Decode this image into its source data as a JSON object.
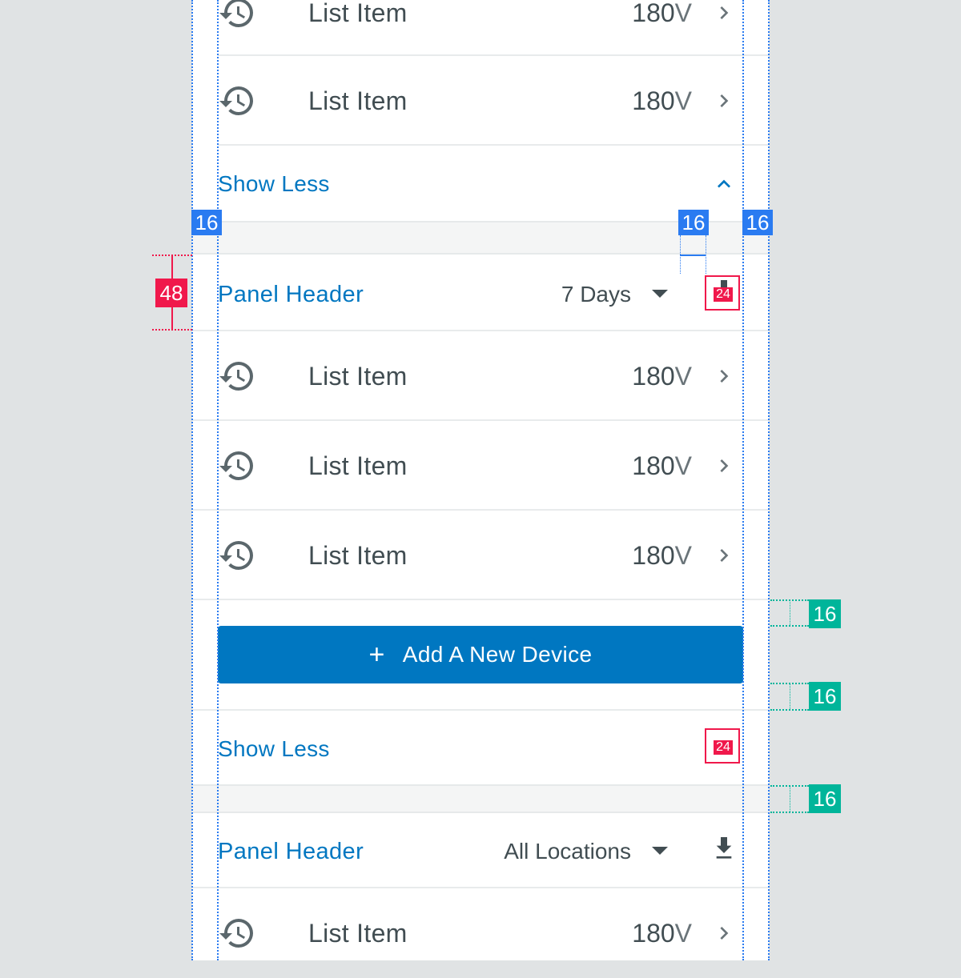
{
  "colors": {
    "background": "#e0e3e4",
    "panel": "#ffffff",
    "accent": "#0077c1",
    "text": "#414d52",
    "redline_blue": "#2a7bf1",
    "redline_red": "#f0184b",
    "redline_green": "#00b59a"
  },
  "list_top": {
    "items": [
      {
        "label": "List Item",
        "value": "180",
        "unit": "V",
        "icon": "history-icon"
      },
      {
        "label": "List Item",
        "value": "180",
        "unit": "V",
        "icon": "history-icon"
      }
    ],
    "toggle_label": "Show Less",
    "toggle_icon": "chevron-up-icon"
  },
  "panel_1": {
    "title": "Panel Header",
    "filter_value": "7 Days",
    "action_icon": "download-icon",
    "items": [
      {
        "label": "List Item",
        "value": "180",
        "unit": "V",
        "icon": "history-icon"
      },
      {
        "label": "List Item",
        "value": "180",
        "unit": "V",
        "icon": "history-icon"
      },
      {
        "label": "List Item",
        "value": "180",
        "unit": "V",
        "icon": "history-icon"
      }
    ],
    "button_label": "Add A New Device",
    "button_icon": "plus-icon",
    "toggle_label": "Show Less"
  },
  "panel_2": {
    "title": "Panel Header",
    "filter_value": "All Locations",
    "action_icon": "download-icon",
    "items": [
      {
        "label": "List Item",
        "value": "180",
        "unit": "V",
        "icon": "history-icon"
      }
    ]
  },
  "redlines": {
    "margin_left": "16",
    "margin_icon": "16",
    "margin_right": "16",
    "header_height": "48",
    "icon_size_1": "24",
    "icon_size_2": "24",
    "gap_1": "16",
    "gap_2": "16",
    "gap_3": "16"
  }
}
